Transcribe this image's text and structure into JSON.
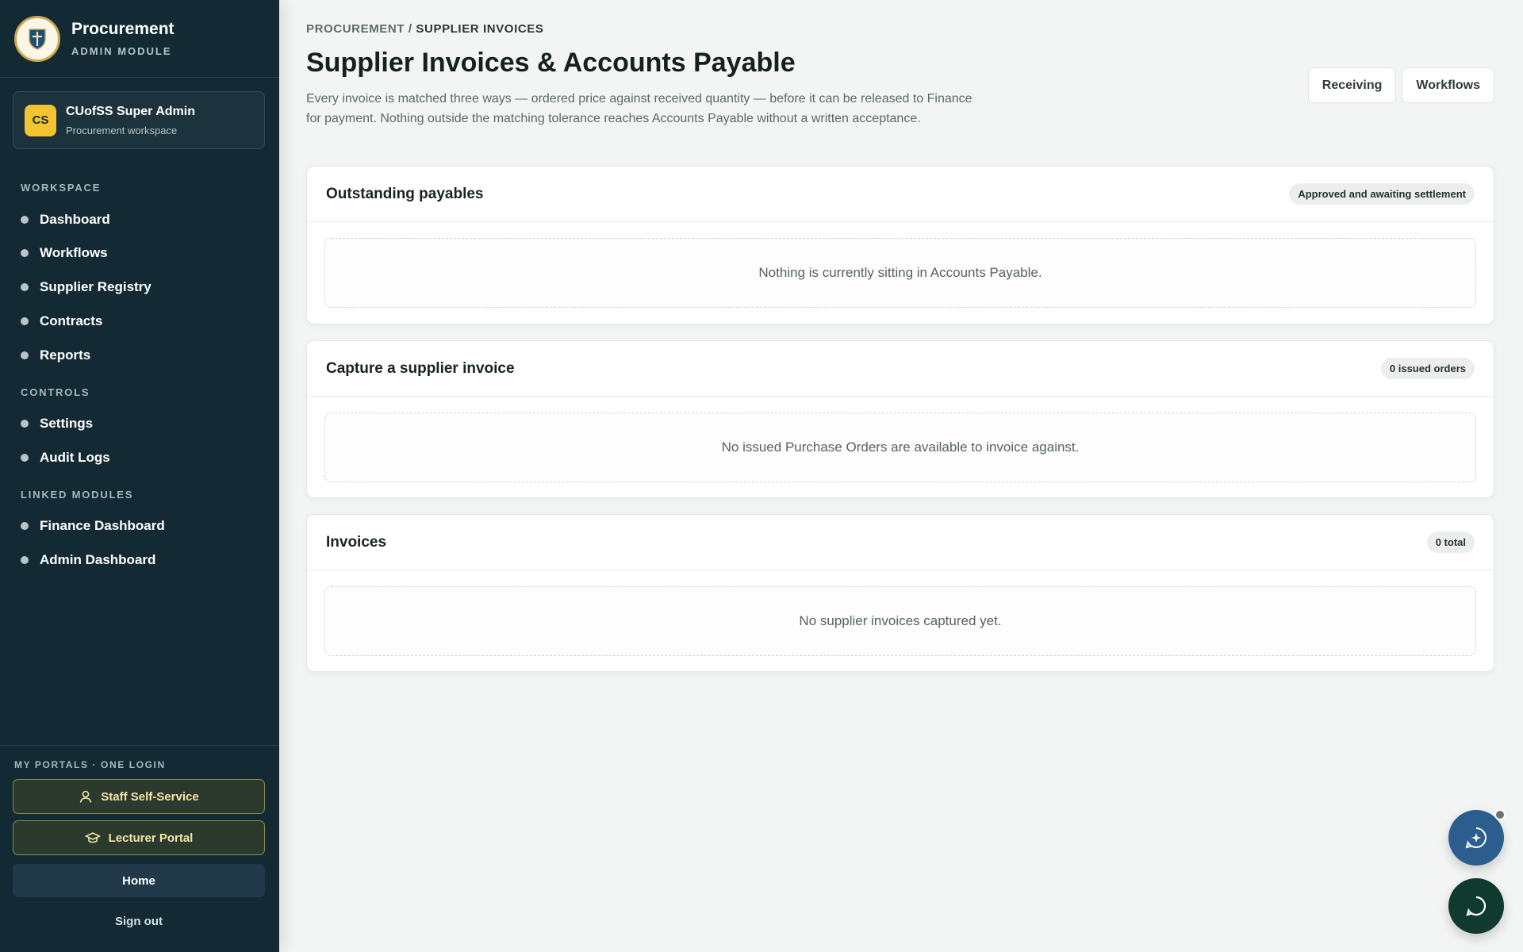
{
  "brand": {
    "title": "Procurement",
    "subtitle": "ADMIN MODULE"
  },
  "user": {
    "initials": "CS",
    "name": "CUofSS Super Admin",
    "role": "Procurement workspace"
  },
  "sidebar": {
    "workspace_label": "WORKSPACE",
    "workspace_items": [
      {
        "label": "Dashboard"
      },
      {
        "label": "Workflows"
      },
      {
        "label": "Supplier Registry"
      },
      {
        "label": "Contracts"
      },
      {
        "label": "Reports"
      }
    ],
    "controls_label": "CONTROLS",
    "controls_items": [
      {
        "label": "Settings"
      },
      {
        "label": "Audit Logs"
      }
    ],
    "linked_label": "LINKED MODULES",
    "linked_items": [
      {
        "label": "Finance Dashboard"
      },
      {
        "label": "Admin Dashboard"
      }
    ],
    "portals_label": "MY PORTALS · ONE LOGIN",
    "staff_self_service": "Staff Self-Service",
    "lecturer_portal": "Lecturer Portal",
    "home": "Home",
    "sign_out": "Sign out"
  },
  "header": {
    "breadcrumb_root": "PROCUREMENT",
    "breadcrumb_separator": " / ",
    "breadcrumb_current": "SUPPLIER INVOICES",
    "title": "Supplier Invoices & Accounts Payable",
    "description": "Every invoice is matched three ways — ordered price against received quantity — before it can be released to Finance for payment. Nothing outside the matching tolerance reaches Accounts Payable without a written acceptance.",
    "receiving_button": "Receiving",
    "workflows_button": "Workflows"
  },
  "cards": {
    "payables": {
      "title": "Outstanding payables",
      "badge": "Approved and awaiting settlement",
      "empty": "Nothing is currently sitting in Accounts Payable."
    },
    "capture": {
      "title": "Capture a supplier invoice",
      "badge": "0 issued orders",
      "empty": "No issued Purchase Orders are available to invoice against."
    },
    "invoices": {
      "title": "Invoices",
      "badge": "0 total",
      "empty": "No supplier invoices captured yet."
    }
  },
  "icons": {
    "logo": "crest-icon",
    "staff": "person-icon",
    "lecturer": "graduation-cap-icon",
    "assistant": "sparkle-chat-icon",
    "chat": "chat-bubble-icon"
  },
  "colors": {
    "sidebar_bg": "#132a35",
    "avatar_bg": "#f4c430",
    "assistant_fab": "#2c5d8f",
    "chat_fab": "#103a2e"
  }
}
